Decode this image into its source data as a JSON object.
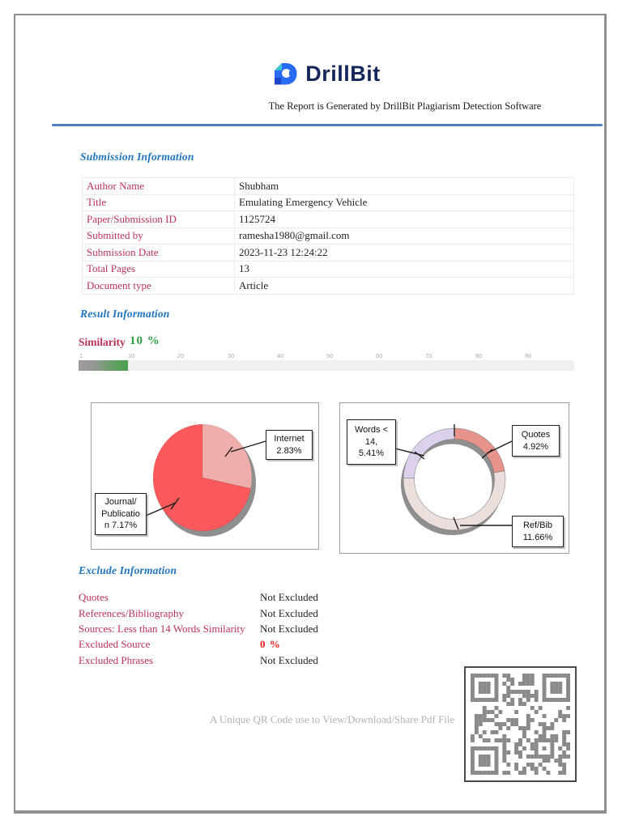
{
  "header": {
    "logo_text": "DrillBit",
    "tagline": "The Report is Generated by DrillBit Plagiarism Detection Software"
  },
  "submission": {
    "heading": "Submission Information",
    "rows": [
      {
        "label": "Author Name",
        "value": "Shubham"
      },
      {
        "label": "Title",
        "value": "Emulating Emergency Vehicle"
      },
      {
        "label": "Paper/Submission ID",
        "value": "1125724"
      },
      {
        "label": "Submitted by",
        "value": "ramesha1980@gmail.com"
      },
      {
        "label": "Submission Date",
        "value": "2023-11-23 12:24:22"
      },
      {
        "label": "Total Pages",
        "value": "13"
      },
      {
        "label": "Document type",
        "value": "Article"
      }
    ]
  },
  "result": {
    "heading": "Result Information",
    "similarity_label": "Similarity",
    "similarity_value": "10 %",
    "similarity_percent": 10,
    "scale_ticks": [
      "1",
      "10",
      "20",
      "30",
      "40",
      "50",
      "60",
      "70",
      "80",
      "90"
    ]
  },
  "chart_data": [
    {
      "type": "pie",
      "labels": [
        "Internet",
        "Journal/Publication"
      ],
      "values": [
        2.83,
        7.17
      ],
      "unit": "%",
      "colors": [
        "#efaeab",
        "#f9595b"
      ],
      "shadow_color": "#8f8f8f",
      "callouts": [
        {
          "lines": [
            "Internet",
            "2.83%"
          ]
        },
        {
          "lines": [
            "Journal/",
            "Publicatio",
            "n 7.17%"
          ]
        }
      ]
    },
    {
      "type": "donut",
      "labels": [
        "Quotes",
        "Ref/Bib",
        "Words < 14"
      ],
      "values": [
        4.92,
        11.66,
        5.41
      ],
      "unit": "%",
      "colors": [
        "#e6938c",
        "#eadfda",
        "#dcd0ec"
      ],
      "shadow_color": "#8f8f8f",
      "callouts": [
        {
          "lines": [
            "Quotes",
            "4.92%"
          ]
        },
        {
          "lines": [
            "Ref/Bib",
            "11.66%"
          ]
        },
        {
          "lines": [
            "Words <",
            "14,",
            "5.41%"
          ]
        }
      ]
    }
  ],
  "exclude": {
    "heading": "Exclude Information",
    "rows": [
      {
        "label": "Quotes",
        "value": "Not Excluded"
      },
      {
        "label": "References/Bibliography",
        "value": "Not Excluded"
      },
      {
        "label": "Sources: Less than 14 Words Similarity",
        "value": "Not Excluded"
      },
      {
        "label": "Excluded Source",
        "value": "0 %"
      },
      {
        "label": "Excluded Phrases",
        "value": "Not Excluded"
      }
    ]
  },
  "footer": {
    "qr_caption": "A Unique QR Code use to View/Download/Share Pdf File"
  },
  "colors": {
    "heading_blue": "#1f74bd",
    "rule_blue": "#4d82b8",
    "label_crimson": "#bb3158",
    "similarity_green": "#2f9c3f",
    "excluded_red": "#e31b1b",
    "logo_navy": "#15265a",
    "logo_blue": "#2a6bf3",
    "logo_teal": "#38c3cd",
    "qr_gray": "#8a8a8a"
  }
}
